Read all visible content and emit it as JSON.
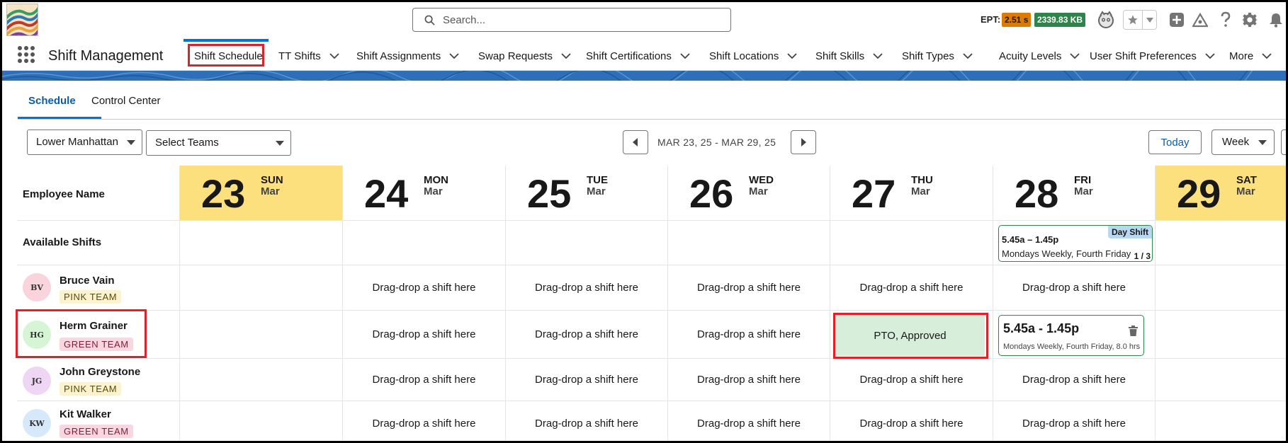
{
  "header": {
    "search_placeholder": "Search...",
    "ept_label": "EPT:",
    "ept_time": "2.51 s",
    "ept_size": "2339.83 KB",
    "colors": {
      "time_badge": "#dd7a01",
      "size_badge": "#2e844a",
      "accent": "#0176d3"
    }
  },
  "nav": {
    "app_name": "Shift Management",
    "items": [
      {
        "label": "Shift Schedule"
      },
      {
        "label": "TT Shifts"
      },
      {
        "label": "Shift Assignments"
      },
      {
        "label": "Swap Requests"
      },
      {
        "label": "Shift Certifications"
      },
      {
        "label": "Shift Locations"
      },
      {
        "label": "Shift Skills"
      },
      {
        "label": "Shift Types"
      },
      {
        "label": "Acuity Levels"
      },
      {
        "label": "User Shift Preferences"
      },
      {
        "label": "More"
      }
    ]
  },
  "tabs": [
    {
      "label": "Schedule"
    },
    {
      "label": "Control Center"
    }
  ],
  "filters": {
    "location": "Lower Manhattan",
    "teams": "Select Teams",
    "date_range": "MAR 23, 25 - MAR 29, 25",
    "today_label": "Today",
    "view": "Week"
  },
  "schedule": {
    "employee_header": "Employee Name",
    "available_label": "Available Shifts",
    "days": [
      {
        "num": "23",
        "dow": "SUN",
        "mon": "Mar"
      },
      {
        "num": "24",
        "dow": "MON",
        "mon": "Mar"
      },
      {
        "num": "25",
        "dow": "TUE",
        "mon": "Mar"
      },
      {
        "num": "26",
        "dow": "WED",
        "mon": "Mar"
      },
      {
        "num": "27",
        "dow": "THU",
        "mon": "Mar"
      },
      {
        "num": "28",
        "dow": "FRI",
        "mon": "Mar"
      },
      {
        "num": "29",
        "dow": "SAT",
        "mon": "Mar"
      }
    ],
    "drop_text": "Drag-drop a shift here",
    "available_shift": {
      "time": "5.45a – 1.45p",
      "description": "Mondays Weekly, Fourth Friday",
      "type": "Day Shift",
      "count": "1 / 3"
    },
    "employees": [
      {
        "initials": "BV",
        "name": "Bruce Vain",
        "team": "PINK TEAM"
      },
      {
        "initials": "HG",
        "name": "Herm Grainer",
        "team": "GREEN TEAM"
      },
      {
        "initials": "JG",
        "name": "John Greystone",
        "team": "PINK TEAM"
      },
      {
        "initials": "KW",
        "name": "Kit Walker",
        "team": "GREEN TEAM"
      }
    ],
    "pto_text": "PTO, Approved",
    "assigned_shift": {
      "time": "5.45a - 1.45p",
      "description": "Mondays Weekly, Fourth Friday, 8.0 hrs"
    }
  }
}
